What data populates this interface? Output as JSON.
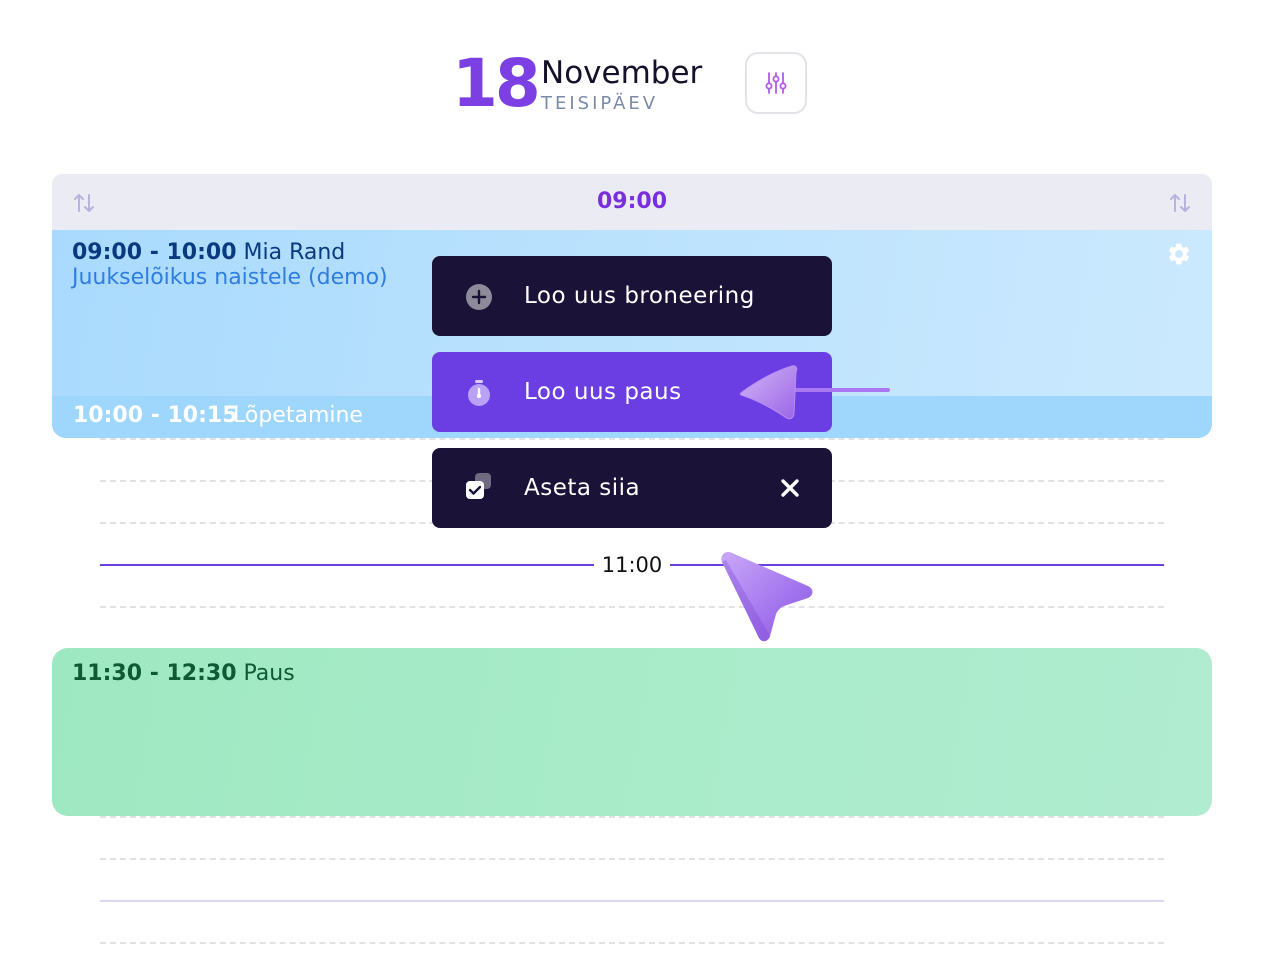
{
  "header": {
    "day": "18",
    "month": "November",
    "weekday": "TEISIPÄEV",
    "filter_icon": "sliders-icon"
  },
  "time_header": {
    "label": "09:00",
    "left_icon": "sort-arrows-icon",
    "right_icon": "sort-arrows-icon"
  },
  "booking": {
    "time_range": "09:00 - 10:00",
    "client": "Mia Rand",
    "service": "Juukselõikus naistele (demo)",
    "settings_icon": "gear-icon",
    "finishing_time": "10:00 - 10:15",
    "finishing_label": "Lõpetamine"
  },
  "context_menu": {
    "items": [
      {
        "label": "Loo uus broneering",
        "icon": "plus-circle-icon"
      },
      {
        "label": "Loo uus paus",
        "icon": "timer-icon"
      },
      {
        "label": "Aseta siia",
        "icon": "paste-icon",
        "close_icon": "close-icon"
      }
    ]
  },
  "current_time": {
    "label": "11:00"
  },
  "pause": {
    "time_range": "11:30 - 12:30",
    "label": "Paus"
  },
  "colors": {
    "accent": "#7b3fe4",
    "menu_bg": "#1a1337",
    "menu_active": "#6a3ee3",
    "booking_bg": "#b7e0fd",
    "pause_bg": "#a6eac8"
  }
}
